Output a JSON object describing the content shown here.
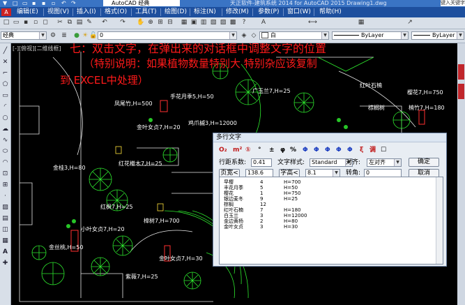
{
  "titlebar": {
    "workspace": "AutoCAD 经典",
    "title": "天正软件-建筑系统 2014   for AutoCAD 2015      Drawing1.dwg",
    "help_search": "键入关键字"
  },
  "menu": {
    "items": [
      "编辑(E)",
      "视图(V)",
      "插入(I)",
      "格式(O)",
      "工具(T)",
      "绘图(D)",
      "标注(N)",
      "修改(M)",
      "参数(P)",
      "窗口(W)",
      "帮助(H)"
    ]
  },
  "toolbar": {
    "workspace_combo": "经典",
    "layer_combo": "0",
    "color_combo": "白",
    "linetype_combo": "ByLayer",
    "lineweight_combo": "ByLayer"
  },
  "viewport_tag": "[-][俯视][二维线框]",
  "annotation": {
    "line1": "七：双击文字，在弹出来的对话框中调整文字的位置",
    "line2": "（特别说明：如果植物数量特别大      特别杂应该复制",
    "line3": "到 EXCEL中处理）"
  },
  "plant_labels": [
    "广玉兰7,H=25",
    "手花月季5,H=50",
    "樱花7,H=750",
    "红叶石楠",
    "楠竹7,H=180",
    "棕榈树",
    "凤尾竹,H=500",
    "金叶女贞7,H=20",
    "金桂3,H=80",
    "红花檵木7,H=25",
    "小叶女贞7,H=20",
    "金丝桃,H=50",
    "紫薇7,H=25",
    "樟树7,H=700",
    "金叶女贞7,H=30",
    "鸡爪槭3,H=12000",
    "红枫7,H=25"
  ],
  "dialog": {
    "title": "多行文字",
    "format_icons": [
      "O₂",
      "m²",
      "①",
      "°",
      "±",
      "φ",
      "%",
      "Φ",
      "Φ",
      "Φ",
      "Φ",
      "Φ",
      "ξ",
      "调",
      "☐"
    ],
    "line_spacing_label": "行距系数:",
    "line_spacing_value": "0.41",
    "text_style_label": "文字样式:",
    "text_style_value": "Standard",
    "align_label": "对齐:",
    "align_value": "左对齐",
    "ok": "确定",
    "page_width_btn": "页宽<",
    "page_width_value": "138.6",
    "char_height_btn": "字高<",
    "char_height_value": "8.1",
    "rotation_label": "转角:",
    "rotation_value": "0",
    "cancel": "取消",
    "rows": [
      {
        "name": "早樱",
        "count": "4",
        "size": "H=700"
      },
      {
        "name": "丰花月季",
        "count": "5",
        "size": "H=50"
      },
      {
        "name": "樱花",
        "count": "1",
        "size": "H=750"
      },
      {
        "name": "银边麦冬",
        "count": "9",
        "size": "H=25"
      },
      {
        "name": "棕榈",
        "count": "12",
        "size": ""
      },
      {
        "name": "红叶石楠",
        "count": "7",
        "size": "H=180"
      },
      {
        "name": "白玉兰",
        "count": "3",
        "size": "H=12000"
      },
      {
        "name": "金边黄杨",
        "count": "2",
        "size": "H=80"
      },
      {
        "name": "金叶女贞",
        "count": "3",
        "size": "H=30"
      }
    ]
  }
}
